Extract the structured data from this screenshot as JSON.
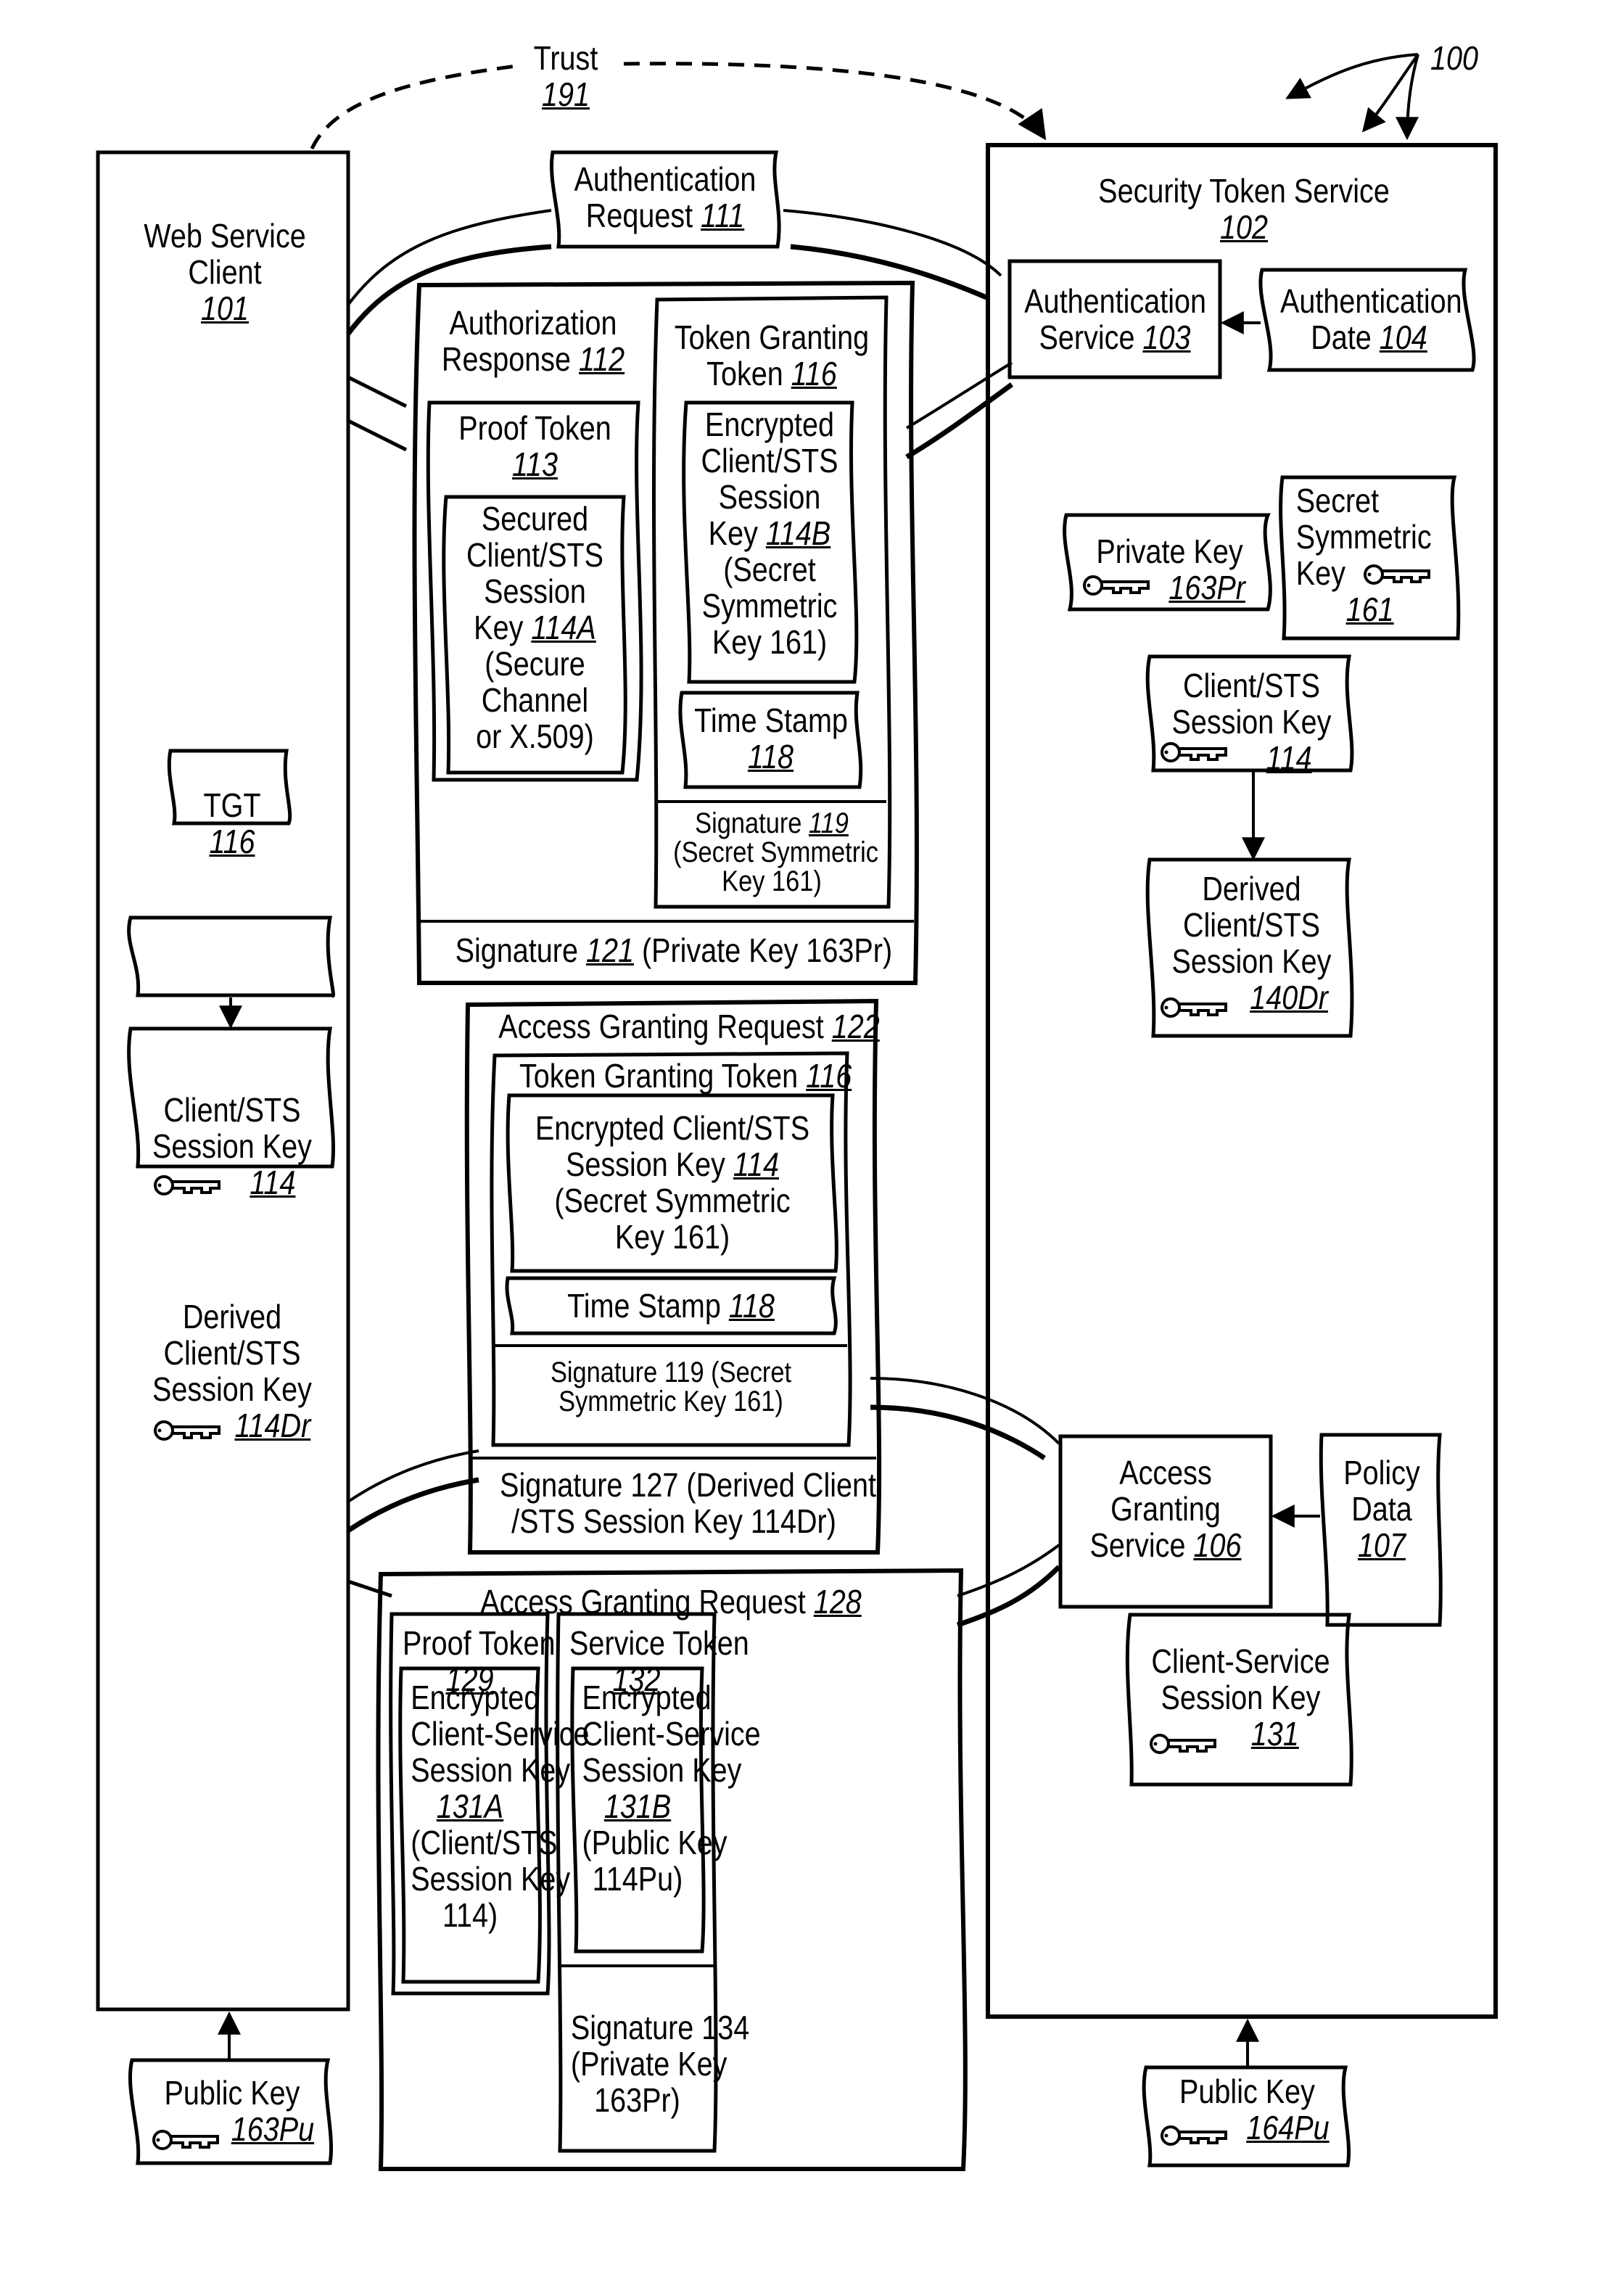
{
  "figure": {
    "ref": "100",
    "trust": {
      "label": "Trust",
      "ref": "191"
    }
  },
  "web_service_client": {
    "title_lines": [
      "Web Service",
      "Client"
    ],
    "ref": "101",
    "tgt": {
      "label": "TGT",
      "ref": "116"
    },
    "session_key": {
      "lines": [
        "Client/STS",
        "Session Key"
      ],
      "ref": "114"
    },
    "derived_key": {
      "lines": [
        "Derived",
        "Client/STS",
        "Session Key"
      ],
      "ref": "114Dr"
    },
    "public_key": {
      "label": "Public Key",
      "ref": "163Pu"
    }
  },
  "security_token_service": {
    "title": "Security Token Service",
    "ref": "102",
    "auth_service": {
      "lines": [
        "Authentication",
        "Service"
      ],
      "ref": "103"
    },
    "auth_data": {
      "lines": [
        "Authentication",
        "Date"
      ],
      "ref": "104"
    },
    "private_key": {
      "label": "Private Key",
      "ref": "163Pr"
    },
    "secret_key": {
      "lines": [
        "Secret",
        "Symmetric",
        "Key"
      ],
      "ref": "161"
    },
    "session_key": {
      "lines": [
        "Client/STS",
        "Session Key"
      ],
      "ref": "114"
    },
    "derived_key": {
      "lines": [
        "Derived",
        "Client/STS",
        "Session Key"
      ],
      "ref": "140Dr"
    },
    "access_granting_service": {
      "lines": [
        "Access",
        "Granting",
        "Service"
      ],
      "ref": "106"
    },
    "policy_data": {
      "lines": [
        "Policy",
        "Data"
      ],
      "ref": "107"
    },
    "client_service_key": {
      "lines": [
        "Client-Service",
        "Session Key"
      ],
      "ref": "131"
    },
    "public_key": {
      "label": "Public Key",
      "ref": "164Pu"
    }
  },
  "auth_request": {
    "lines": [
      "Authentication",
      "Request"
    ],
    "ref": "111"
  },
  "auth_response": {
    "lines": [
      "Authorization",
      "Response"
    ],
    "ref": "112",
    "proof_token": {
      "label": "Proof Token",
      "ref": "113",
      "inner": {
        "lines": [
          "Secured",
          "Client/STS",
          "Session",
          "Key"
        ],
        "ref": "114A",
        "note": [
          "(Secure",
          "Channel",
          "or X.509)"
        ]
      }
    },
    "tgt": {
      "lines": [
        "Token Granting",
        "Token"
      ],
      "ref": "116",
      "encrypted": {
        "lines": [
          "Encrypted",
          "Client/STS",
          "Session",
          "Key"
        ],
        "ref": "114B",
        "note": [
          "(Secret",
          "Symmetric",
          "Key 161)"
        ]
      },
      "timestamp": {
        "label": "Time Stamp",
        "ref": "118"
      },
      "signature": {
        "label": "Signature",
        "ref": "119",
        "note": [
          "(Secret Symmetric",
          "Key 161)"
        ]
      }
    },
    "signature": {
      "label": "Signature",
      "ref": "121",
      "note": "(Private Key 163Pr)"
    }
  },
  "access_request_122": {
    "title": "Access Granting Request",
    "ref": "122",
    "tgt": {
      "label": "Token Granting Token",
      "ref": "116",
      "encrypted": {
        "lines": [
          "Encrypted Client/STS",
          "Session Key"
        ],
        "ref": "114",
        "note": [
          "(Secret Symmetric",
          "Key 161)"
        ]
      },
      "timestamp": {
        "label": "Time Stamp",
        "ref": "118"
      },
      "signature": {
        "lines": [
          "Signature 119 (Secret",
          "Symmetric Key 161)"
        ]
      }
    },
    "signature": {
      "lines": [
        "Signature 127 (Derived Client",
        "/STS Session Key 114Dr)"
      ]
    }
  },
  "access_request_128": {
    "title": "Access Granting Request",
    "ref": "128",
    "proof_token": {
      "label": "Proof Token",
      "ref": "129",
      "inner": {
        "lines": [
          "Encrypted",
          "Client-Service",
          "Session Key"
        ],
        "ref": "131A",
        "note": [
          "(Client/STS",
          "Session Key",
          "114)"
        ]
      }
    },
    "service_token": {
      "label": "Service Token",
      "ref": "132",
      "inner": {
        "lines": [
          "Encrypted",
          "Client-Service",
          "Session Key"
        ],
        "ref": "131B",
        "note": [
          "(Public Key",
          "114Pu)"
        ]
      },
      "signature": {
        "lines": [
          "Signature 134",
          "(Private Key",
          "163Pr)"
        ]
      }
    }
  }
}
